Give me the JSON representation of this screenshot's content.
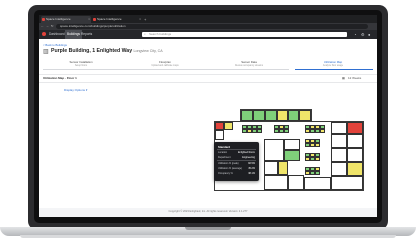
{
  "browser": {
    "tabs": [
      {
        "label": "Space Intelligence"
      },
      {
        "label": "Space Intelligence"
      }
    ],
    "new_tab": "+",
    "url": "space.intelligence.com/buildings/purple/utilization",
    "nav_back": "←",
    "nav_forward": "→",
    "nav_reload": "↻"
  },
  "app": {
    "nav": [
      {
        "label": "Dashboard"
      },
      {
        "label": "Buildings"
      },
      {
        "label": "Reports"
      }
    ],
    "search_placeholder": "Search buildings",
    "icons": [
      "bell-icon",
      "gear-icon",
      "user-icon"
    ]
  },
  "page": {
    "back_link": "< Back to Buildings",
    "title": "Purple Building, 1 Enlighted Way",
    "subtitle": "Longview City, CA",
    "steps": [
      {
        "label": "Sensor Installation",
        "sub": "Setup floors"
      },
      {
        "label": "Floorplan",
        "sub": "Upload and calibrate maps"
      },
      {
        "label": "Sensor Data",
        "sub": "Review occupancy streams"
      },
      {
        "label": "Utilization Map",
        "sub": "Analyze floor usage"
      }
    ],
    "active_step": 3,
    "floor_label": "Utilization Map - Floor 1",
    "date_range": "12 Weeks",
    "display_options": "Display Options ▾",
    "footer": "Copyright © 2023 Enlighted, Inc. All rights reserved. Version: 2.1.277"
  },
  "tooltip": {
    "title": "Standard",
    "rows": [
      {
        "label": "Location",
        "value": "Enlighted Room"
      },
      {
        "label": "Department",
        "value": "Engineering"
      },
      {
        "label": "Utilization % (peak)",
        "value": "82.5%"
      },
      {
        "label": "Utilization % (average)",
        "value": "45.2%"
      },
      {
        "label": "Occupancy %",
        "value": "38.1%"
      }
    ]
  },
  "colors": {
    "accent": "#2f6fd1",
    "high_use": "#e2433b",
    "medium_use": "#f0e56a",
    "low_use": "#7fd07a",
    "app_bar": "#26272b"
  }
}
